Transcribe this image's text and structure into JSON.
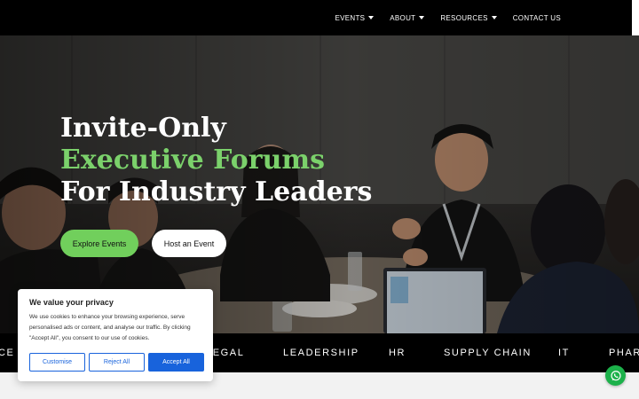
{
  "nav": {
    "items": [
      {
        "label": "EVENTS",
        "has_dropdown": true
      },
      {
        "label": "ABOUT",
        "has_dropdown": true
      },
      {
        "label": "RESOURCES",
        "has_dropdown": true
      },
      {
        "label": "CONTACT US",
        "has_dropdown": false
      }
    ]
  },
  "hero": {
    "line1": "Invite-Only",
    "line2": "Executive Forums",
    "line3": "For Industry Leaders",
    "primary_button": "Explore Events",
    "secondary_button": "Host an Event",
    "accent_color": "#7bd16b"
  },
  "ticker": {
    "items": [
      "CE",
      "LEGAL",
      "LEADERSHIP",
      "HR",
      "SUPPLY CHAIN",
      "IT",
      "PHARM"
    ]
  },
  "cookie": {
    "title": "We value your privacy",
    "body": "We use cookies to enhance your browsing experience, serve personalised ads or content, and analyse our traffic. By clicking \"Accept All\", you consent to our use of cookies.",
    "customise": "Customise",
    "reject": "Reject All",
    "accept": "Accept All",
    "button_color": "#1863dc"
  },
  "whatsapp": {
    "icon": "whatsapp-icon",
    "color": "#1cb14a"
  }
}
